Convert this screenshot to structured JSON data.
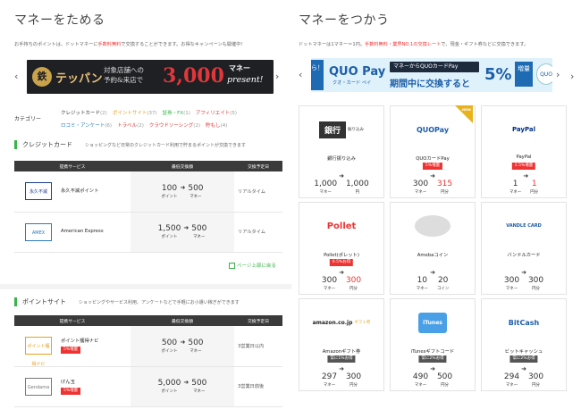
{
  "left": {
    "title": "マネーをためる",
    "intro_pre": "お手持ちのポイントは、ドットマネーに",
    "intro_red": "手数料無料",
    "intro_post": "で交換することができます。お得なキャンペーンも開催中！",
    "banner": {
      "logo": "鉄",
      "brand": "テッパン",
      "line1": "対象店舗への",
      "line2": "予約&来店で",
      "amount": "3,000",
      "currency": "マネー",
      "present": "present!"
    },
    "categories_label": "カテゴリー",
    "categories_row1": [
      {
        "name": "クレジットカード",
        "count": "(2)",
        "color": "#333333"
      },
      {
        "name": "ポイントサイト",
        "count": "(37)",
        "color": "#e8a21b"
      },
      {
        "name": "証券・FX",
        "count": "(1)",
        "color": "#3bb34a"
      },
      {
        "name": "アフィリエイト",
        "count": "(5)",
        "color": "#e33333"
      }
    ],
    "categories_row2": [
      {
        "name": "ロコミ・アンケート",
        "count": "(6)",
        "color": "#1d7ac4"
      },
      {
        "name": "トラベル",
        "count": "(2)",
        "color": "#e33333"
      },
      {
        "name": "クラウドソーシング",
        "count": "(2)",
        "color": "#e33333"
      },
      {
        "name": "貯もし",
        "count": "(4)",
        "color": "#e33333"
      }
    ],
    "credit": {
      "heading": "クレジットカード",
      "desc": "ショッピングなど日常のクレジットカード利用で貯まるポイントが交換できます",
      "columns": [
        "提携サービス",
        "最低交換額",
        "交換予定日"
      ],
      "rows": [
        {
          "logo": "永久不滅",
          "name": "永久不滅ポイント",
          "from": "100",
          "from_unit": "ポイント",
          "to": "500",
          "to_unit": "マネー",
          "timing": "リアルタイム",
          "logo_color": "#1a3d8f"
        },
        {
          "logo": "AMEX",
          "name": "American Express",
          "from": "1,500",
          "from_unit": "ポイント",
          "to": "500",
          "to_unit": "マネー",
          "timing": "リアルタイム",
          "logo_color": "#2e77bb"
        }
      ]
    },
    "page_top": "ページ上部に戻る",
    "point": {
      "heading": "ポイントサイト",
      "desc": "ショッピングやサービス利用、アンケートなどで手軽にお小遣い稼ぎができます",
      "columns": [
        "提携サービス",
        "最低交換額",
        "交換予定日"
      ],
      "rows": [
        {
          "logo": "ポイント獲得ナビ",
          "name": "ポイント獲得ナビ",
          "badge": "5%増量",
          "from": "500",
          "from_unit": "ポイント",
          "to": "500",
          "to_unit": "マネー",
          "timing": "3営業日以内",
          "logo_color": "#e8a21b"
        },
        {
          "logo": "Gendama",
          "name": "げん玉",
          "badge": "5%増量",
          "from": "5,000",
          "from_unit": "ポイント",
          "to": "500",
          "to_unit": "マネー",
          "timing": "3営業日前後",
          "logo_color": "#777777"
        }
      ]
    }
  },
  "right": {
    "title": "マネーをつかう",
    "intro_pre": "ドットマネーは1マネー＝1円。",
    "intro_red": "手数料無料・業界NO.1の交換レート",
    "intro_post": "で、現金・ギフト券などに交換できます。",
    "banner": {
      "side": "ら！",
      "logo": "QUO Pay",
      "logo_sub": "クオ・カード ペイ",
      "header": "マネーからQUOカードPay",
      "body": "期間中に交換すると",
      "pct": "5%",
      "zo": "増量",
      "bear": "QUO"
    },
    "new_label": "NEW",
    "cards": [
      {
        "icon": "銀行",
        "icon_sub": "振り込み",
        "name": "銀行振り込み",
        "badge": "",
        "from": "1,000",
        "from_unit": "マネー",
        "to": "1,000",
        "to_unit": "円",
        "to_red": false,
        "new": false
      },
      {
        "icon": "QUOPay",
        "icon_sub": "",
        "name": "QUOカードPay",
        "badge": "5%増量",
        "from": "300",
        "from_unit": "マネー",
        "to": "315",
        "to_unit": "円分",
        "to_red": true,
        "new": true
      },
      {
        "icon": "PayPal",
        "icon_sub": "",
        "name": "PayPal",
        "badge": "2.5%増量",
        "from": "1",
        "from_unit": "マネー",
        "to": "1",
        "to_unit": "円分",
        "to_red": true,
        "new": false
      },
      {
        "icon": "Pollet",
        "icon_sub": "",
        "name": "Pollet(ポレット)",
        "badge": "0.5%お得",
        "from": "300",
        "from_unit": "マネー",
        "to": "300",
        "to_unit": "円分",
        "to_red": true,
        "new": false
      },
      {
        "icon": "coins",
        "icon_sub": "",
        "name": "Amebaコイン",
        "badge": "",
        "from": "10",
        "from_unit": "マネー",
        "to": "20",
        "to_unit": "コイン",
        "to_red": false,
        "new": false
      },
      {
        "icon": "VANDLE CARD",
        "icon_sub": "",
        "name": "バンドルカード",
        "badge": "",
        "from": "300",
        "from_unit": "マネー",
        "to": "300",
        "to_unit": "円分",
        "to_red": false,
        "new": false
      },
      {
        "icon": "amazon.co.jp",
        "icon_sub": "ギフト券",
        "name": "Amazonギフト券",
        "badge": "常に1%お得",
        "badge_gray": true,
        "from": "297",
        "from_unit": "マネー",
        "to": "300",
        "to_unit": "円分",
        "to_red": false,
        "new": false
      },
      {
        "icon": "iTunes",
        "icon_sub": "",
        "name": "iTunesギフトコード",
        "badge": "常に2%お得",
        "badge_gray": true,
        "from": "490",
        "from_unit": "マネー",
        "to": "500",
        "to_unit": "円分",
        "to_red": false,
        "new": false
      },
      {
        "icon": "BitCash",
        "icon_sub": "",
        "name": "ビットキャッシュ",
        "badge": "常に2%お得",
        "badge_gray": true,
        "from": "294",
        "from_unit": "マネー",
        "to": "300",
        "to_unit": "円分",
        "to_red": false,
        "new": false
      }
    ]
  },
  "arrow_left": "‹",
  "arrow_right": "›",
  "rate_arrow": "➜"
}
